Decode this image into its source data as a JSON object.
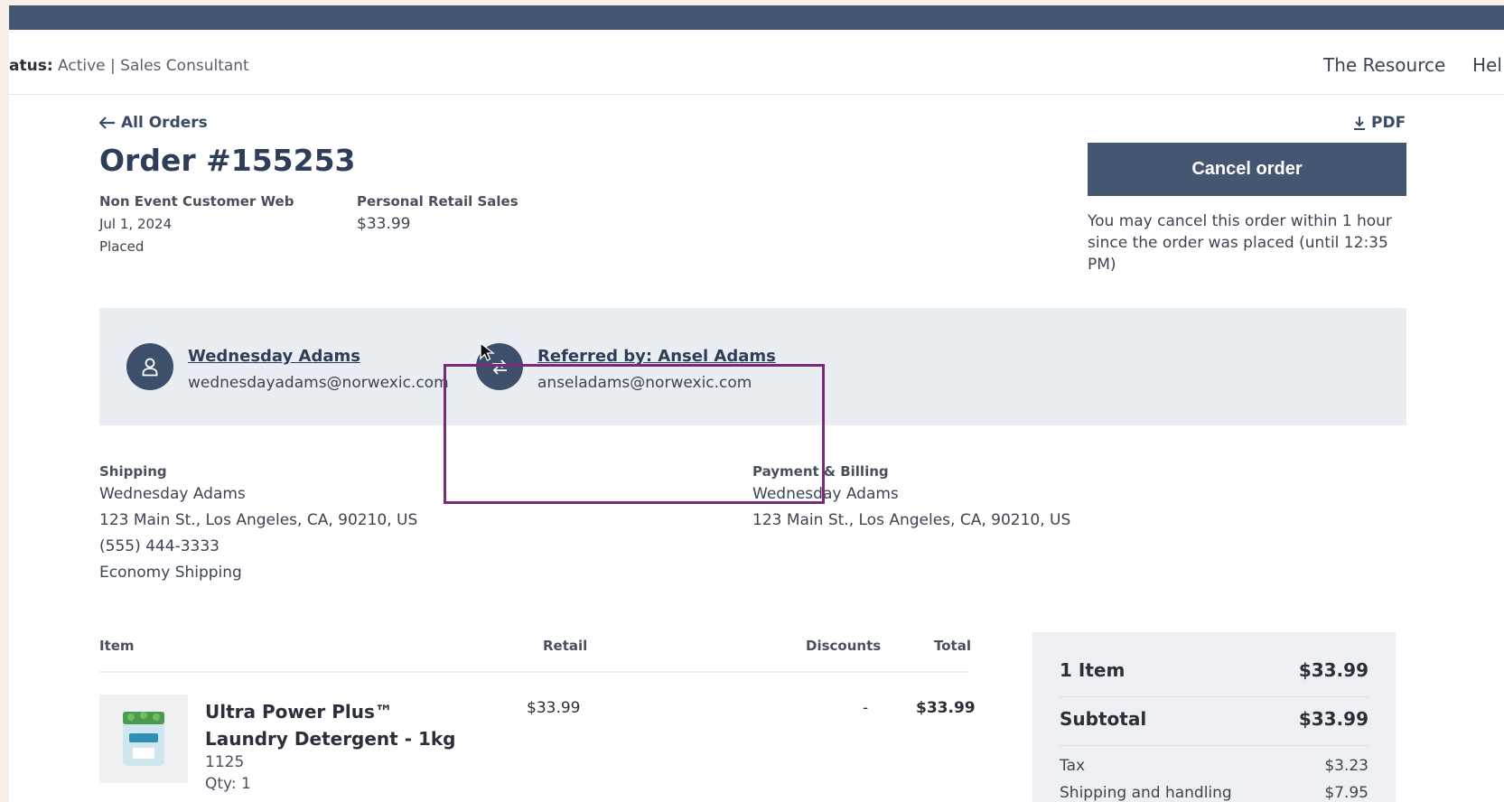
{
  "status": {
    "label": "atus:",
    "value": "Active | Sales Consultant"
  },
  "nav": {
    "resource": "The Resource",
    "help": "Hel"
  },
  "order": {
    "back_label": "All Orders",
    "pdf_label": "PDF",
    "title": "Order #155253",
    "type": "Non Event Customer Web",
    "date": "Jul 1, 2024",
    "state": "Placed",
    "prs_label": "Personal Retail Sales",
    "prs_value": "$33.99",
    "cancel_label": "Cancel order",
    "cancel_note": "You may cancel this order within 1 hour since the order was placed (until 12:35 PM)"
  },
  "customer": {
    "name": "Wednesday Adams",
    "email": "wednesdayadams@norwexic.com",
    "referrer_name": "Referred by: Ansel Adams",
    "referrer_email": "anseladams@norwexic.com"
  },
  "shipping": {
    "heading": "Shipping",
    "name": "Wednesday Adams",
    "address": "123 Main St., Los Angeles, CA, 90210, US",
    "phone": "(555) 444-3333",
    "method": "Economy Shipping"
  },
  "billing": {
    "heading": "Payment & Billing",
    "name": "Wednesday Adams",
    "address": "123 Main St., Los Angeles, CA, 90210, US"
  },
  "items_table": {
    "headers": [
      "Item",
      "Retail",
      "Discounts",
      "Total"
    ],
    "rows": [
      {
        "name": "Ultra Power Plus™ Laundry Detergent - 1kg",
        "sku": "1125",
        "qty": "Qty: 1",
        "retail": "$33.99",
        "discount": "-",
        "total": "$33.99"
      }
    ]
  },
  "summary": {
    "items_label": "1 Item",
    "items_value": "$33.99",
    "subtotal_label": "Subtotal",
    "subtotal_value": "$33.99",
    "tax_label": "Tax",
    "tax_value": "$3.23",
    "shipping_label": "Shipping and handling",
    "shipping_value": "$7.95"
  },
  "colors": {
    "primary": "#445671",
    "panel": "#eaedf2",
    "highlight": "#7a2a7a"
  }
}
